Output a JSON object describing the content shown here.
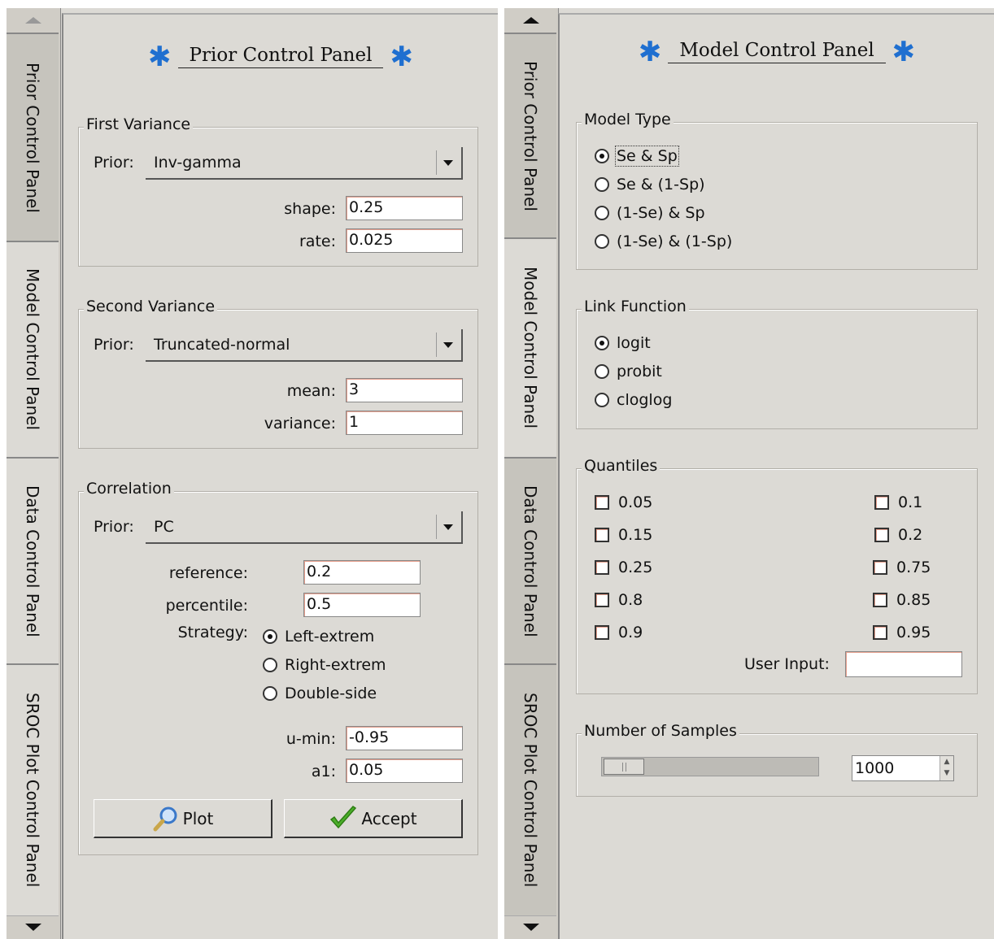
{
  "left": {
    "tabs": [
      "Prior Control Panel",
      "Model Control Panel",
      "Data Control Panel",
      "SROC Plot Control Panel"
    ],
    "title": "Prior Control Panel",
    "first_variance": {
      "legend": "First Variance",
      "prior_label": "Prior:",
      "prior_value": "Inv-gamma",
      "shape_label": "shape:",
      "shape_value": "0.25",
      "rate_label": "rate:",
      "rate_value": "0.025"
    },
    "second_variance": {
      "legend": "Second Variance",
      "prior_label": "Prior:",
      "prior_value": "Truncated-normal",
      "mean_label": "mean:",
      "mean_value": "3",
      "variance_label": "variance:",
      "variance_value": "1"
    },
    "correlation": {
      "legend": "Correlation",
      "prior_label": "Prior:",
      "prior_value": "PC",
      "reference_label": "reference:",
      "reference_value": "0.2",
      "percentile_label": "percentile:",
      "percentile_value": "0.5",
      "strategy_label": "Strategy:",
      "strategies": [
        "Left-extrem",
        "Right-extrem",
        "Double-side"
      ],
      "strategy_selected": "Left-extrem",
      "umin_label": "u-min:",
      "umin_value": "-0.95",
      "a1_label": "a1:",
      "a1_value": "0.05"
    },
    "buttons": {
      "plot": "Plot",
      "accept": "Accept"
    }
  },
  "right": {
    "tabs": [
      "Prior Control Panel",
      "Model Control Panel",
      "Data Control Panel",
      "SROC Plot Control Panel"
    ],
    "title": "Model Control Panel",
    "model_type": {
      "legend": "Model Type",
      "options": [
        "Se & Sp",
        "Se & (1-Sp)",
        "(1-Se) & Sp",
        "(1-Se) & (1-Sp)"
      ],
      "selected": "Se & Sp"
    },
    "link_function": {
      "legend": "Link Function",
      "options": [
        "logit",
        "probit",
        "cloglog"
      ],
      "selected": "logit"
    },
    "quantiles": {
      "legend": "Quantiles",
      "left": [
        "0.05",
        "0.15",
        "0.25",
        "0.8",
        "0.9"
      ],
      "right": [
        "0.1",
        "0.2",
        "0.75",
        "0.85",
        "0.95"
      ],
      "user_input_label": "User Input:",
      "user_input_value": ""
    },
    "samples": {
      "legend": "Number of Samples",
      "value": "1000"
    }
  },
  "colors": {
    "star": "#1f6fd0",
    "panel_bg": "#dcdad5",
    "accept_check": "#4caf2a",
    "plot_lens": "#3a78c9"
  }
}
